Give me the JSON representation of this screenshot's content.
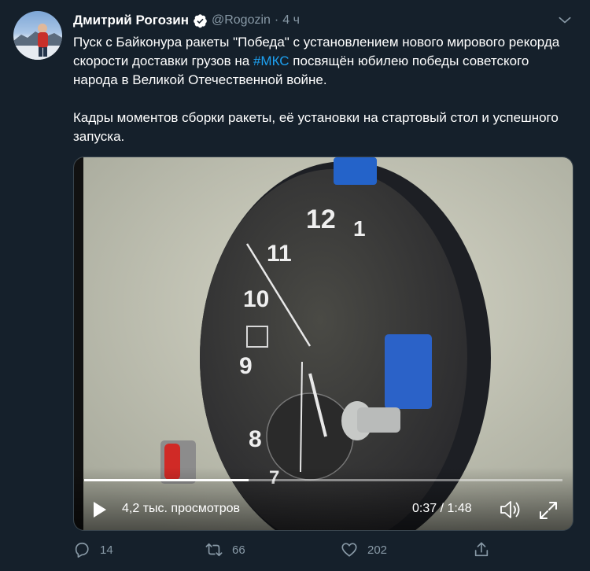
{
  "tweet": {
    "author_name": "Дмитрий Рогозин",
    "author_handle": "@Rogozin",
    "separator": "·",
    "time": "4 ч",
    "text_line1": "Пуск с Байконура ракеты \"Победа\" с установлением нового мирового рекорда скорости доставки грузов на ",
    "hashtag": "#МКС",
    "text_line1b": " посвящён юбилею победы советского народа в Великой Отечественной войне.",
    "text_line2": "Кадры моментов сборки ракеты, её установки на стартовый стол и успешного запуска."
  },
  "video": {
    "views": "4,2 тыс. просмотров",
    "time_display": "0:37 / 1:48",
    "progress": 0.343,
    "clock_numbers": [
      "12",
      "1",
      "11",
      "10",
      "9",
      "8",
      "7"
    ]
  },
  "actions": {
    "replies": "14",
    "retweets": "66",
    "likes": "202"
  },
  "colors": {
    "background": "#15202b",
    "secondary_text": "#8899a6",
    "accent": "#1da1f2",
    "verified": "#1da1f2"
  },
  "icons": [
    "verified-badge-icon",
    "chevron-down-icon",
    "play-icon",
    "volume-icon",
    "fullscreen-icon",
    "reply-icon",
    "retweet-icon",
    "like-icon",
    "share-icon"
  ]
}
